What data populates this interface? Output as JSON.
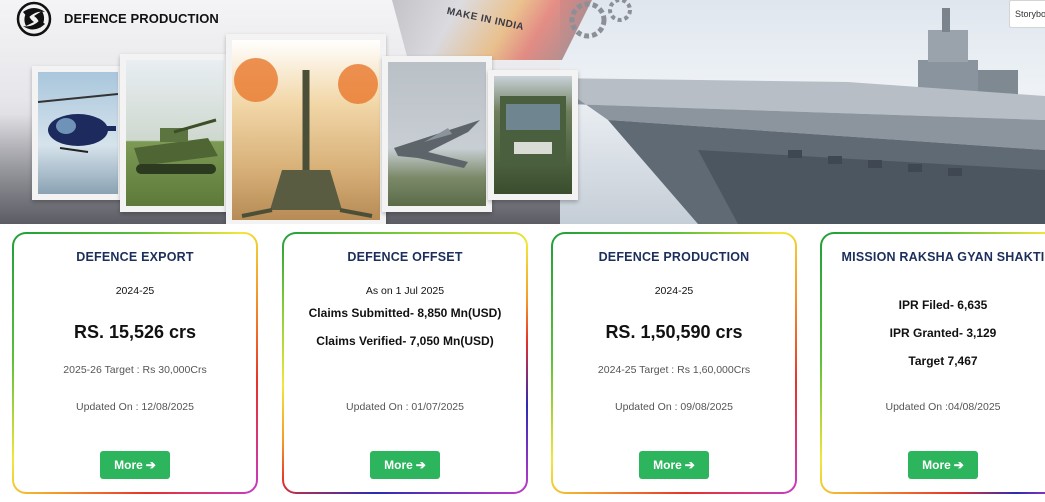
{
  "header": {
    "site_title": "DEFENCE PRODUCTION",
    "storybook_label": "Storybo",
    "banner_text": "MAKE IN INDIA"
  },
  "icons": {
    "logo": "emblem-logo-icon",
    "more_arrow": "arrow-right-icon"
  },
  "colors": {
    "card_title": "#1c2f5c",
    "button": "#2db55d"
  },
  "cards": [
    {
      "title": "DEFENCE EXPORT",
      "subtitle": "2024-25",
      "value": "RS. 15,526 crs",
      "target": "2025-26 Target : Rs 30,000Crs",
      "updated": "Updated On : 12/08/2025",
      "button": "More",
      "arrow": "➔"
    },
    {
      "title": "DEFENCE OFFSET",
      "subtitle": "As on 1 Jul 2025",
      "lines": [
        "Claims Submitted- 8,850 Mn(USD)",
        "Claims Verified- 7,050 Mn(USD)"
      ],
      "updated": "Updated On : 01/07/2025",
      "button": "More",
      "arrow": "➔"
    },
    {
      "title": "DEFENCE PRODUCTION",
      "subtitle": "2024-25",
      "value": "RS. 1,50,590 crs",
      "target": "2024-25 Target : Rs 1,60,000Crs",
      "updated": "Updated On : 09/08/2025",
      "button": "More",
      "arrow": "➔"
    },
    {
      "title": "MISSION RAKSHA GYAN SHAKTI",
      "lines": [
        "IPR Filed- 6,635",
        "IPR Granted- 3,129",
        "Target 7,467"
      ],
      "updated": "Updated On :04/08/2025",
      "button": "More",
      "arrow": "➔"
    }
  ]
}
